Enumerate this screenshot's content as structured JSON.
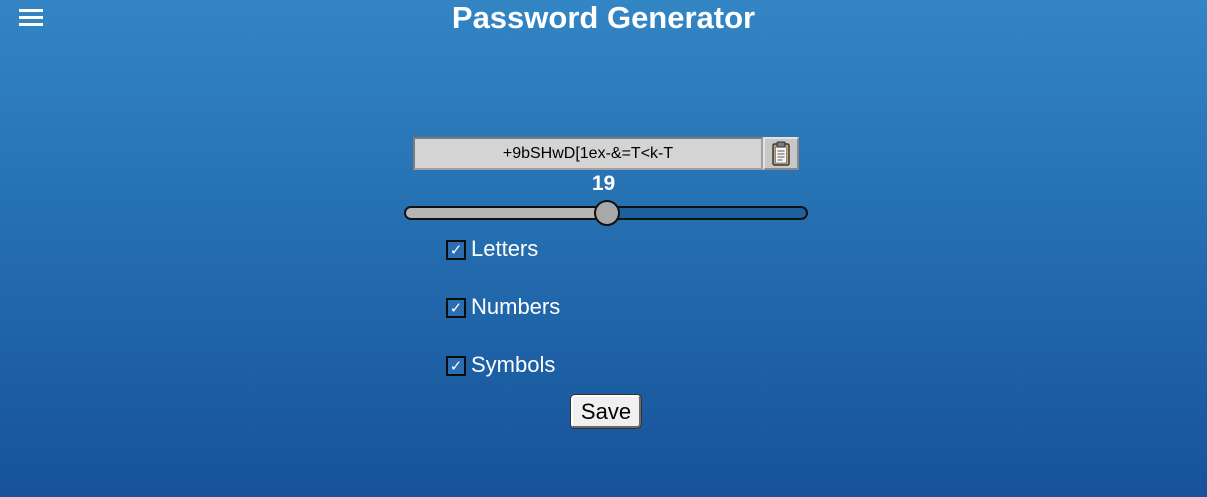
{
  "header": {
    "title": "Password Generator",
    "menu_icon": "hamburger-menu-icon"
  },
  "generator": {
    "password": "+9bSHwD[1ex-&=T<k-T",
    "copy_icon": "clipboard-icon",
    "length": "19",
    "length_fraction": 0.5
  },
  "options": [
    {
      "label": "Letters",
      "checked": true
    },
    {
      "label": "Numbers",
      "checked": true
    },
    {
      "label": "Symbols",
      "checked": true
    }
  ],
  "actions": {
    "save_label": "Save"
  },
  "colors": {
    "background_top": "#3385c4",
    "background_bottom": "#17529a",
    "text": "#ffffff"
  }
}
